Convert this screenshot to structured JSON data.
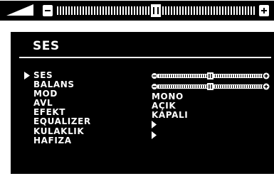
{
  "volume_osd": {
    "level": 0.5
  },
  "menu": {
    "title": "SES",
    "items": [
      {
        "label": "SES",
        "selected": true
      },
      {
        "label": "BALANS",
        "selected": false
      },
      {
        "label": "MOD",
        "selected": false
      },
      {
        "label": "AVL",
        "selected": false
      },
      {
        "label": "EFEKT",
        "selected": false
      },
      {
        "label": "EQUALIZER",
        "selected": false
      },
      {
        "label": "KULAKLIK",
        "selected": false
      },
      {
        "label": "HAFIZA",
        "selected": false
      }
    ],
    "values": {
      "ses_level": 0.5,
      "balans_level": 0.5,
      "mod": "MONO",
      "avl": "AÇIK",
      "efekt": "KAPALI"
    }
  }
}
